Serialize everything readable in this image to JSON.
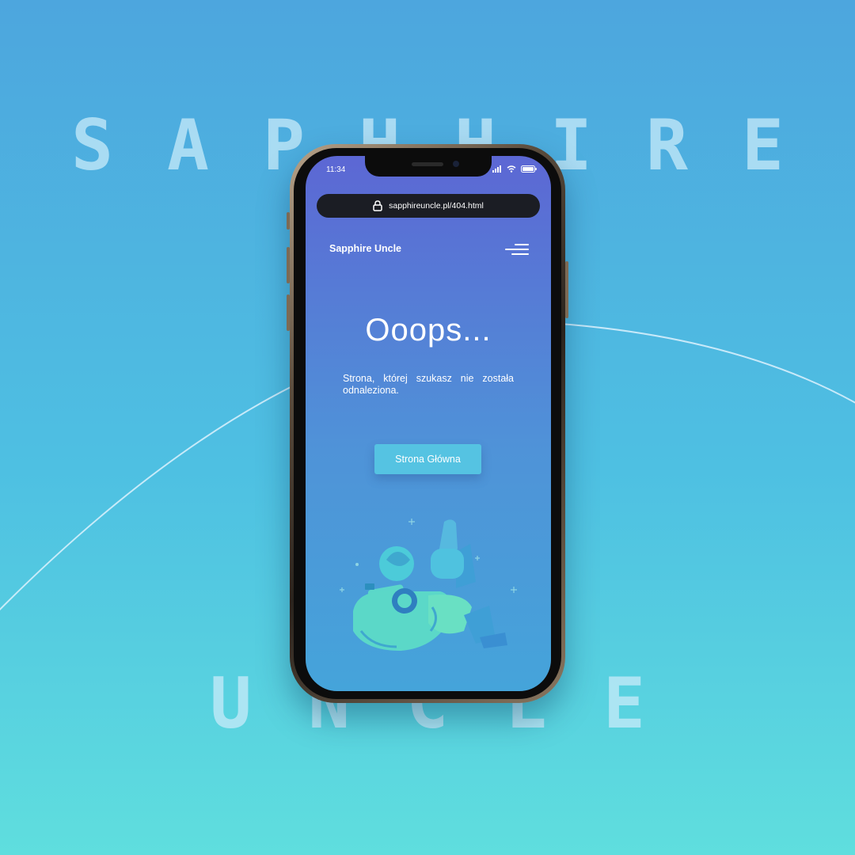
{
  "background": {
    "word_top": [
      "S",
      "A",
      "P",
      "H",
      "H",
      "I",
      "R",
      "E"
    ],
    "word_bottom": [
      "U",
      "N",
      "C",
      "L",
      "E"
    ]
  },
  "status_bar": {
    "time": "11:34"
  },
  "browser": {
    "url": "sapphireuncle.pl/404.html"
  },
  "page": {
    "brand": "Sapphire Uncle",
    "headline": "Ooops...",
    "message": "Strona, której szukasz nie została odnaleziona.",
    "home_button": "Strona Główna"
  },
  "colors": {
    "bg_top": "#4da6de",
    "bg_bottom": "#5fdede",
    "screen_top": "#5c67d4",
    "screen_bottom": "#45a4da",
    "button": "#55c3e2",
    "url_bar": "#1b1d24"
  },
  "icons": [
    "lock-icon",
    "menu-icon",
    "signal-icon",
    "wifi-icon",
    "battery-icon",
    "astronaut-illustration"
  ]
}
